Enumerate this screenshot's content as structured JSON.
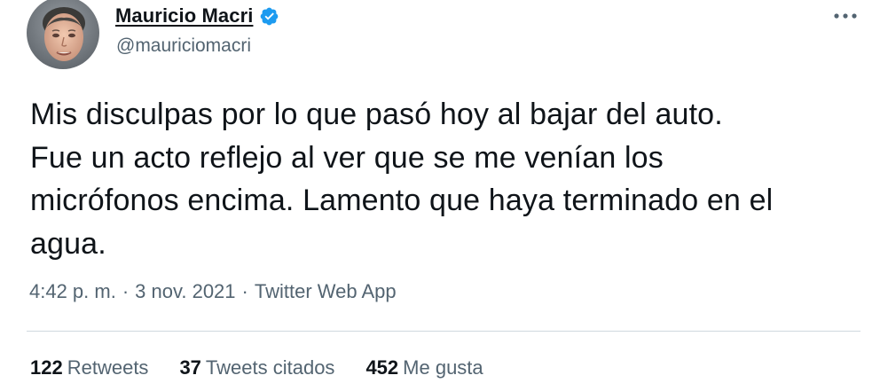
{
  "author": {
    "name": "Mauricio Macri",
    "handle": "@mauriciomacri",
    "verified": true,
    "avatar_icon": "profile-photo-man"
  },
  "tweet": {
    "text": "Mis disculpas por lo que pasó hoy al bajar del auto.\nFue un acto reflejo al ver que se me venían los\nmicrófonos encima. Lamento que haya terminado en el\nagua."
  },
  "meta": {
    "time": "4:42 p. m.",
    "separator": "·",
    "date": "3 nov. 2021",
    "source": "Twitter Web App"
  },
  "stats": {
    "retweets": {
      "count": "122",
      "label": "Retweets"
    },
    "quotes": {
      "count": "37",
      "label": "Tweets citados"
    },
    "likes": {
      "count": "452",
      "label": "Me gusta"
    }
  },
  "icons": {
    "verified": "verified-badge-icon",
    "more": "more-options-icon"
  },
  "colors": {
    "text_primary": "#0f1419",
    "text_secondary": "#536471",
    "verified_blue": "#1d9bf0",
    "divider": "#cfd9de"
  }
}
